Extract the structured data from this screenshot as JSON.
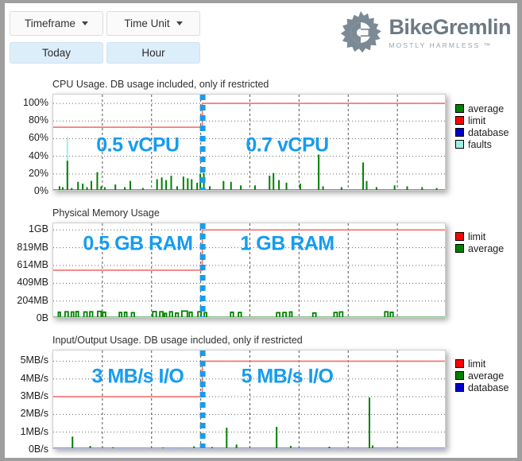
{
  "toolbar": {
    "timeframe_dropdown": "Timeframe",
    "timeframe_value": "Today",
    "timeunit_dropdown": "Time Unit",
    "timeunit_value": "Hour"
  },
  "logo": {
    "name": "BikeGremlin",
    "tagline": "MOSTLY HARMLESS ™"
  },
  "colors": {
    "average": "#008000",
    "limit": "#ff0000",
    "database": "#0000cc",
    "faults": "#9ff0e0",
    "limit_line": "#f2706e",
    "annotation": "#159cf0",
    "divider": "#1a9ae8"
  },
  "chart_data": [
    {
      "id": "cpu",
      "type": "line",
      "title": "CPU Usage. DB usage included, only if restricted",
      "ylabel": "",
      "xlabel": "",
      "ylim": [
        0,
        110
      ],
      "yticks": [
        0,
        20,
        40,
        60,
        80,
        100
      ],
      "ytick_labels": [
        "0%",
        "20%",
        "40%",
        "60%",
        "80%",
        "100%"
      ],
      "grid": true,
      "legend": [
        {
          "label": "average",
          "color": "#008000"
        },
        {
          "label": "limit",
          "color": "#ff0000"
        },
        {
          "label": "database",
          "color": "#0000cc"
        },
        {
          "label": "faults",
          "color": "#9ff0e0"
        }
      ],
      "annotations": [
        {
          "text": "0.5 vCPU",
          "x_frac": 0.215,
          "y_value": 52
        },
        {
          "text": "0.7 vCPU",
          "x_frac": 0.595,
          "y_value": 52
        }
      ],
      "divider_x_frac": 0.38,
      "series": [
        {
          "name": "limit",
          "type": "step",
          "color": "#f2706e",
          "points": [
            [
              0.0,
              73
            ],
            [
              0.379,
              73
            ],
            [
              0.379,
              100
            ],
            [
              1.0,
              100
            ]
          ]
        },
        {
          "name": "database",
          "type": "flat",
          "color": "#0000cc",
          "value": 1.2
        },
        {
          "name": "faults",
          "type": "spikes",
          "color": "#9ff0e0",
          "spikes": [
            [
              0.036,
              62
            ]
          ]
        },
        {
          "name": "average",
          "type": "spikes",
          "color": "#008000",
          "spikes": [
            [
              0.016,
              6
            ],
            [
              0.024,
              5
            ],
            [
              0.036,
              35
            ],
            [
              0.047,
              4
            ],
            [
              0.063,
              11
            ],
            [
              0.075,
              9
            ],
            [
              0.086,
              5
            ],
            [
              0.097,
              12
            ],
            [
              0.112,
              22
            ],
            [
              0.122,
              6
            ],
            [
              0.131,
              5
            ],
            [
              0.158,
              8
            ],
            [
              0.182,
              5
            ],
            [
              0.196,
              12
            ],
            [
              0.228,
              4
            ],
            [
              0.264,
              14
            ],
            [
              0.276,
              16
            ],
            [
              0.287,
              13
            ],
            [
              0.3,
              18
            ],
            [
              0.315,
              6
            ],
            [
              0.331,
              17
            ],
            [
              0.342,
              15
            ],
            [
              0.352,
              14
            ],
            [
              0.366,
              10
            ],
            [
              0.374,
              20
            ],
            [
              0.383,
              21
            ],
            [
              0.398,
              6
            ],
            [
              0.433,
              12
            ],
            [
              0.452,
              11
            ],
            [
              0.477,
              7
            ],
            [
              0.513,
              7
            ],
            [
              0.55,
              18
            ],
            [
              0.56,
              21
            ],
            [
              0.574,
              13
            ],
            [
              0.593,
              10
            ],
            [
              0.628,
              9
            ],
            [
              0.675,
              42
            ],
            [
              0.686,
              6
            ],
            [
              0.733,
              5
            ],
            [
              0.788,
              33
            ],
            [
              0.797,
              12
            ],
            [
              0.822,
              5
            ],
            [
              0.868,
              7
            ],
            [
              0.9,
              6
            ],
            [
              0.938,
              5
            ],
            [
              0.975,
              4
            ]
          ]
        }
      ]
    },
    {
      "id": "memory",
      "type": "line",
      "title": "Physical Memory Usage",
      "ylabel": "",
      "xlabel": "",
      "ylim": [
        0,
        1100
      ],
      "yticks": [
        0,
        204,
        409,
        614,
        819,
        1024
      ],
      "ytick_labels": [
        "0B",
        "204MB",
        "409MB",
        "614MB",
        "819MB",
        "1GB"
      ],
      "grid": true,
      "legend": [
        {
          "label": "limit",
          "color": "#ff0000"
        },
        {
          "label": "average",
          "color": "#008000"
        }
      ],
      "annotations": [
        {
          "text": "0.5 GB RAM",
          "x_frac": 0.215,
          "y_value": 860
        },
        {
          "text": "1 GB RAM",
          "x_frac": 0.595,
          "y_value": 860
        }
      ],
      "divider_x_frac": 0.38,
      "series": [
        {
          "name": "limit",
          "type": "step",
          "color": "#f2706e",
          "points": [
            [
              0.0,
              560
            ],
            [
              0.379,
              560
            ],
            [
              0.379,
              1024
            ],
            [
              1.0,
              1024
            ]
          ]
        },
        {
          "name": "average",
          "type": "squares",
          "color": "#008000",
          "bands": [
            [
              0.013,
              0.018,
              75
            ],
            [
              0.03,
              0.038,
              80
            ],
            [
              0.046,
              0.052,
              78
            ],
            [
              0.058,
              0.064,
              82
            ],
            [
              0.078,
              0.086,
              78
            ],
            [
              0.093,
              0.1,
              80
            ],
            [
              0.113,
              0.122,
              85
            ],
            [
              0.126,
              0.133,
              75
            ],
            [
              0.168,
              0.174,
              72
            ],
            [
              0.181,
              0.187,
              74
            ],
            [
              0.199,
              0.206,
              70
            ],
            [
              0.253,
              0.262,
              82
            ],
            [
              0.271,
              0.279,
              80
            ],
            [
              0.283,
              0.288,
              62
            ],
            [
              0.296,
              0.303,
              80
            ],
            [
              0.311,
              0.318,
              65
            ],
            [
              0.327,
              0.341,
              88
            ],
            [
              0.346,
              0.353,
              75
            ],
            [
              0.368,
              0.376,
              80
            ],
            [
              0.384,
              0.39,
              70
            ],
            [
              0.451,
              0.458,
              74
            ],
            [
              0.471,
              0.478,
              72
            ],
            [
              0.568,
              0.576,
              70
            ],
            [
              0.584,
              0.592,
              72
            ],
            [
              0.601,
              0.607,
              78
            ],
            [
              0.66,
              0.668,
              66
            ],
            [
              0.714,
              0.722,
              72
            ],
            [
              0.728,
              0.736,
              78
            ],
            [
              0.843,
              0.851,
              80
            ],
            [
              0.857,
              0.864,
              74
            ]
          ]
        }
      ]
    },
    {
      "id": "io",
      "type": "line",
      "title": "Input/Output Usage. DB usage included, only if restricted",
      "ylabel": "",
      "xlabel": "",
      "ylim": [
        0,
        5.6
      ],
      "yticks": [
        0,
        1,
        2,
        3,
        4,
        5
      ],
      "ytick_labels": [
        "0B/s",
        "1MB/s",
        "2MB/s",
        "3MB/s",
        "4MB/s",
        "5MB/s"
      ],
      "grid": true,
      "legend": [
        {
          "label": "limit",
          "color": "#ff0000"
        },
        {
          "label": "average",
          "color": "#008000"
        },
        {
          "label": "database",
          "color": "#0000cc"
        }
      ],
      "annotations": [
        {
          "text": "3 MB/s I/O",
          "x_frac": 0.215,
          "y_value": 4.1
        },
        {
          "text": "5 MB/s I/O",
          "x_frac": 0.595,
          "y_value": 4.1
        }
      ],
      "divider_x_frac": 0.38,
      "series": [
        {
          "name": "limit",
          "type": "step",
          "color": "#f2706e",
          "points": [
            [
              0.0,
              3.0
            ],
            [
              0.379,
              3.0
            ],
            [
              0.379,
              5.0
            ],
            [
              1.0,
              5.0
            ]
          ]
        },
        {
          "name": "database",
          "type": "flat",
          "color": "#0000cc",
          "value": 0.06
        },
        {
          "name": "average",
          "type": "spikes",
          "color": "#008000",
          "spikes": [
            [
              0.049,
              0.75
            ],
            [
              0.094,
              0.22
            ],
            [
              0.152,
              0.15
            ],
            [
              0.279,
              0.14
            ],
            [
              0.328,
              0.12
            ],
            [
              0.358,
              0.2
            ],
            [
              0.404,
              0.16
            ],
            [
              0.441,
              1.25
            ],
            [
              0.466,
              0.3
            ],
            [
              0.568,
              1.3
            ],
            [
              0.604,
              0.22
            ],
            [
              0.702,
              0.18
            ],
            [
              0.804,
              2.95
            ],
            [
              0.812,
              0.25
            ],
            [
              0.9,
              0.12
            ]
          ]
        }
      ]
    }
  ]
}
